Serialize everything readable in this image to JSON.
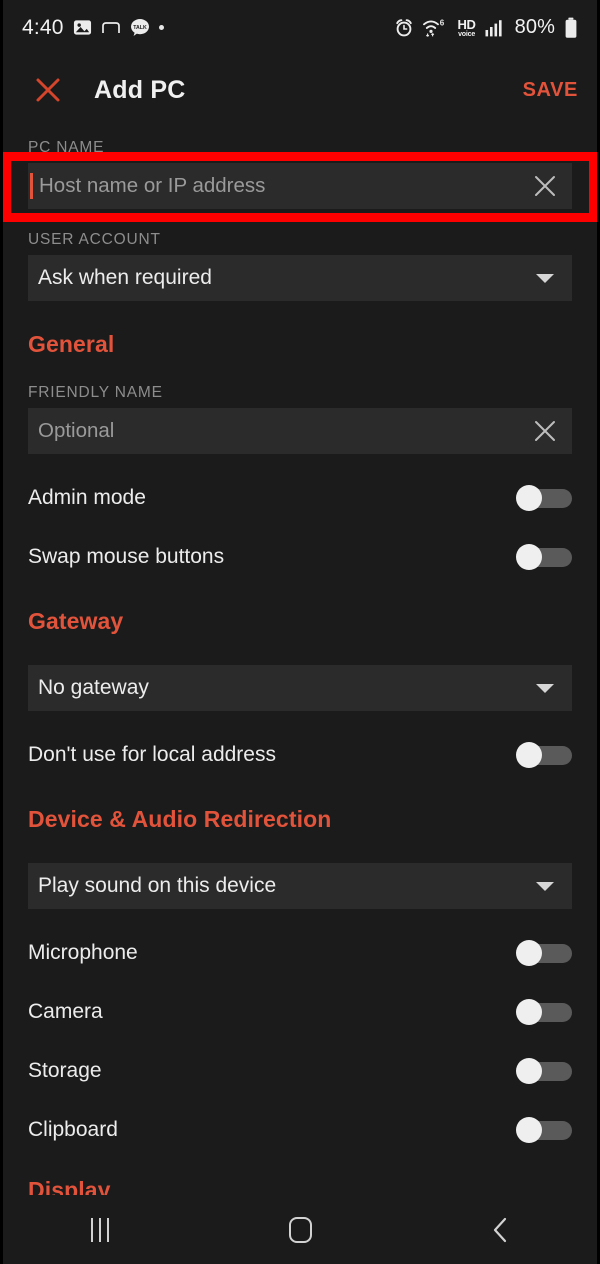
{
  "status_bar": {
    "time": "4:40",
    "left_icons": [
      "gallery-icon",
      "arc-notification-icon",
      "kakaotalk-icon",
      "dot-icon"
    ],
    "right_icons": [
      "alarm-icon",
      "wifi-6-icon",
      "hd-voice-icon",
      "signal-bars-icon"
    ],
    "hd_label_top": "HD",
    "hd_label_bottom": "voice",
    "wifi_badge": "6",
    "battery_percent": "80%"
  },
  "app_bar": {
    "close_label": "close-icon",
    "title": "Add PC",
    "save_label": "SAVE"
  },
  "form": {
    "pc_name_label": "PC NAME",
    "pc_name_placeholder": "Host name or IP address",
    "pc_name_value": "",
    "user_account_label": "USER ACCOUNT",
    "user_account_value": "Ask when required"
  },
  "general": {
    "heading": "General",
    "friendly_name_label": "FRIENDLY NAME",
    "friendly_name_placeholder": "Optional",
    "friendly_name_value": "",
    "toggles": [
      {
        "label": "Admin mode",
        "on": false
      },
      {
        "label": "Swap mouse buttons",
        "on": false
      }
    ]
  },
  "gateway": {
    "heading": "Gateway",
    "select_value": "No gateway",
    "toggles": [
      {
        "label": "Don't use for local address",
        "on": false
      }
    ]
  },
  "device_audio": {
    "heading": "Device & Audio Redirection",
    "select_value": "Play sound on this device",
    "toggles": [
      {
        "label": "Microphone",
        "on": false
      },
      {
        "label": "Camera",
        "on": false
      },
      {
        "label": "Storage",
        "on": false
      },
      {
        "label": "Clipboard",
        "on": false
      }
    ]
  },
  "display": {
    "heading": "Display"
  },
  "nav_bar": {
    "recents_label": "recents-icon",
    "home_label": "home-icon",
    "back_label": "back-icon"
  },
  "colors": {
    "accent": "#e2533b",
    "highlight": "#ff0000",
    "page_bg": "#1b1b1b",
    "field_bg": "#2b2b2b",
    "label_gray": "#8d8d8d"
  }
}
